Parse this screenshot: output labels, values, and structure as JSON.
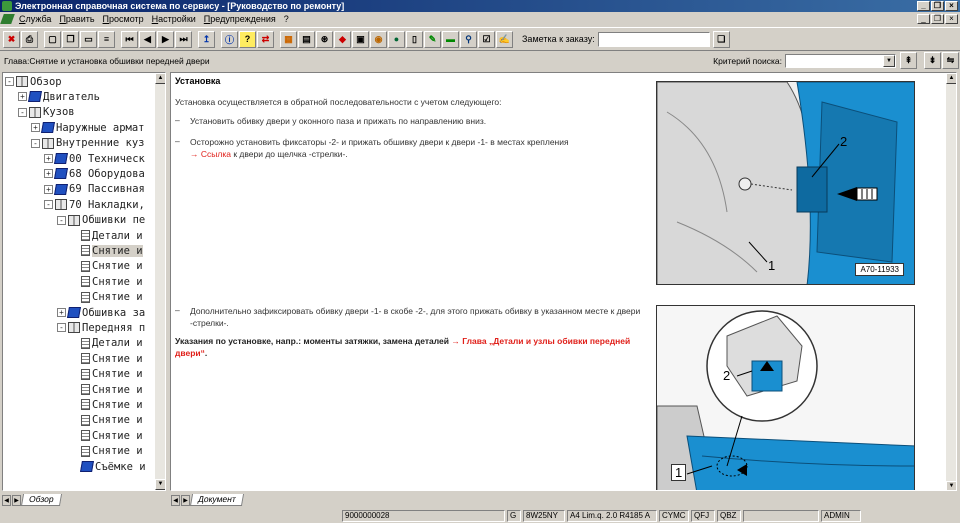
{
  "window": {
    "title": "Электронная справочная система по сервису - [Руководство по ремонту]",
    "controls": [
      "_",
      "❐",
      "×"
    ]
  },
  "menu": {
    "items": [
      "Служба",
      "Править",
      "Просмотр",
      "Настройки",
      "Предупреждения",
      "?"
    ]
  },
  "toolbar": {
    "note_label": "Заметка к заказу:",
    "note_value": ""
  },
  "chapterbar": {
    "chapter": "Глава:Снятие и установка обшивки передней двери",
    "search_label": "Критерий поиска:",
    "search_value": ""
  },
  "tree": {
    "items": [
      {
        "label": "Обзор",
        "icon": "book-open-icon",
        "exp": "-"
      },
      {
        "label": "Двигатель",
        "icon": "book-icon",
        "exp": "+"
      },
      {
        "label": "Кузов",
        "icon": "book-open-icon",
        "exp": "-"
      },
      {
        "label": "Наружные армат",
        "icon": "book-icon",
        "exp": "+"
      },
      {
        "label": "Внутренние куз",
        "icon": "book-open-icon",
        "exp": "-"
      },
      {
        "label": "00 Техническ",
        "icon": "book-icon",
        "exp": "+"
      },
      {
        "label": "68 Оборудова",
        "icon": "book-icon",
        "exp": "+"
      },
      {
        "label": "69 Пассивная",
        "icon": "book-icon",
        "exp": "+"
      },
      {
        "label": "70 Накладки,",
        "icon": "book-open-icon",
        "exp": "-"
      },
      {
        "label": "Обшивки пе",
        "icon": "book-open-icon",
        "exp": "-"
      },
      {
        "label": "Детали и",
        "icon": "page-icon",
        "exp": ""
      },
      {
        "label": "Снятие и",
        "icon": "page-icon",
        "exp": ""
      },
      {
        "label": "Снятие и",
        "icon": "page-icon",
        "exp": ""
      },
      {
        "label": "Снятие и",
        "icon": "page-icon",
        "exp": ""
      },
      {
        "label": "Снятие и",
        "icon": "page-icon",
        "exp": ""
      },
      {
        "label": "Обшивка за",
        "icon": "book-icon",
        "exp": "+"
      },
      {
        "label": "Передняя п",
        "icon": "book-open-icon",
        "exp": "-"
      },
      {
        "label": "Детали и",
        "icon": "page-icon",
        "exp": ""
      },
      {
        "label": "Снятие и",
        "icon": "page-icon",
        "exp": ""
      },
      {
        "label": "Снятие и",
        "icon": "page-icon",
        "exp": ""
      },
      {
        "label": "Снятие и",
        "icon": "page-icon",
        "exp": ""
      },
      {
        "label": "Снятие и",
        "icon": "page-icon",
        "exp": ""
      },
      {
        "label": "Снятие и",
        "icon": "page-icon",
        "exp": ""
      },
      {
        "label": "Снятие и",
        "icon": "page-icon",
        "exp": ""
      },
      {
        "label": "Снятие и",
        "icon": "page-icon",
        "exp": ""
      },
      {
        "label": "Съёмке и",
        "icon": "book-icon",
        "exp": ""
      }
    ],
    "tab_label": "Обзор"
  },
  "content": {
    "section_title": "Установка",
    "intro": "Установка осуществляется в обратной последовательности с учетом следующего:",
    "dash": "–",
    "step1": "Установить обивку двери у оконного паза и прижать по направлению вниз.",
    "step2a": "Осторожно установить фиксаторы -2- и прижать обшивку двери к двери -1- в местах крепления",
    "step2_link": "→ Ссылка",
    "step2b": " к двери до щелчка -стрелки-.",
    "step3": "Дополнительно зафиксировать обивку двери -1- в скобе -2-, для этого прижать обивку в указанном месте к двери -стрелки-.",
    "note_prefix": "Указания по установке, напр.: моменты затяжки, замена деталей ",
    "note_link": "→ Глава „Детали и узлы обивки передней двери“",
    "note_end": ".",
    "figure1_code": "A70-11933",
    "figure1_label1": "1",
    "figure1_label2": "2",
    "figure2_label1": "1",
    "figure2_label2": "2",
    "doc_tab_label": "Документ"
  },
  "status": {
    "fields": [
      "9000000028",
      "G",
      "8W25NY",
      "A4 Lim.q. 2.0 R4185 A",
      "CYMC",
      "QFJ",
      "QBZ",
      "ADMIN"
    ]
  },
  "colors": {
    "title_gradient_start": "#0a246a",
    "link_red": "#e0201a",
    "figure_blue": "#1a8fd0"
  }
}
